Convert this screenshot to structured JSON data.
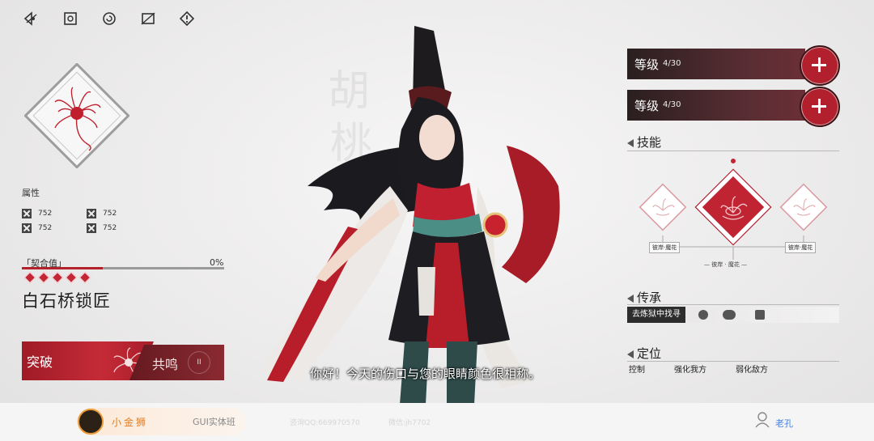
{
  "top_icons": [
    "eye-slash-icon",
    "portrait-icon",
    "refresh-icon",
    "hide-image-icon",
    "alert-icon"
  ],
  "attributes": {
    "title": "属性",
    "items": [
      {
        "icon": "attribute-icon",
        "value": "752"
      },
      {
        "icon": "attribute-icon",
        "value": "752"
      },
      {
        "icon": "attribute-icon",
        "value": "752"
      },
      {
        "icon": "attribute-icon",
        "value": "752"
      }
    ]
  },
  "fusion": {
    "label": "「契合值」",
    "percent_text": "0%",
    "progress": 0.4,
    "diamonds": 5
  },
  "location": "白石桥锁匠",
  "actions": {
    "breakthrough": "突破",
    "resonance": "共鸣",
    "resonance_icon_text": "II"
  },
  "subtitle": "你好！今天的伤口与您的眼睛颜色很相称。",
  "levels": [
    {
      "label": "等级",
      "value": "4/30"
    },
    {
      "label": "等级",
      "value": "4/30"
    }
  ],
  "skills": {
    "title": "技能",
    "left_label": "彼岸·魔花",
    "right_label": "彼岸·魔花",
    "center_label": "— 彼岸 · 魔花 —"
  },
  "inheritance": {
    "title": "传承",
    "tag": "去炼狱中找寻"
  },
  "positioning": {
    "title": "定位",
    "items": [
      "控制",
      "强化我方",
      "弱化敌方"
    ]
  },
  "footer": {
    "brand": "小金狮",
    "course": "GUI实体班",
    "qq": "咨询QQ:669970570",
    "wechat": "微信:jh7702",
    "user": "老孔"
  },
  "colors": {
    "accent": "#b3212b",
    "dark_bar": "#2a1f20",
    "footer_brand": "#e07b22",
    "user_link": "#3f7fe0"
  }
}
